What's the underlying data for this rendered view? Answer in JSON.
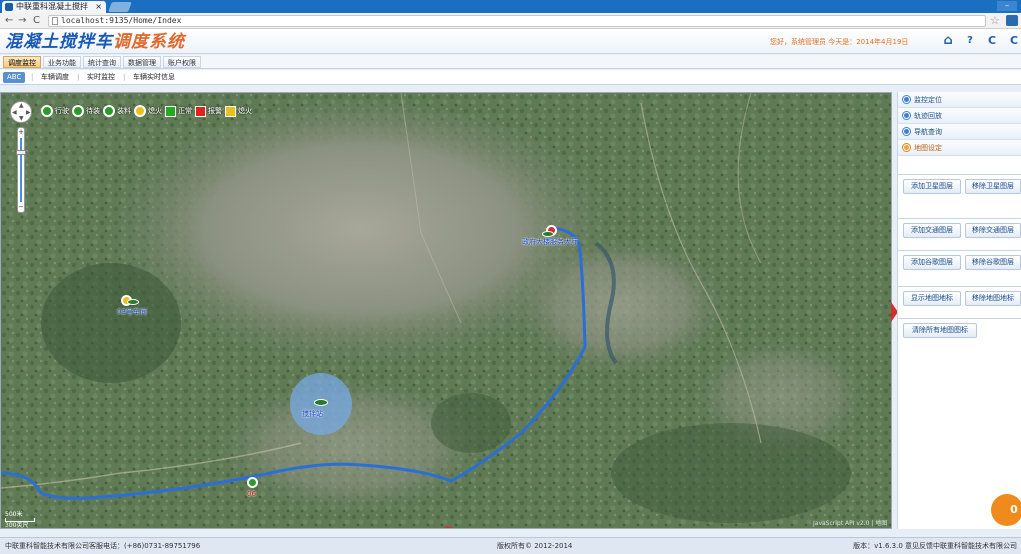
{
  "browser": {
    "tab_title": "中联重科混凝土搅拌",
    "tab_close": "×",
    "url": "localhost:9135/Home/Index",
    "back": "←",
    "forward": "→",
    "reload": "C",
    "star": "☆"
  },
  "header": {
    "title_part1": "混凝土搅拌车",
    "title_part2": "调度系统",
    "welcome": "您好，系统管理员 今天是：2014年4月19日",
    "home_icon": "⌂",
    "help_icon": "?",
    "refresh_icon": "C",
    "more_icon": "C"
  },
  "menu_primary": [
    "调度监控",
    "业务功能",
    "统计查询",
    "数据管理",
    "账户权限"
  ],
  "menu_secondary": [
    "ABC",
    "车辆调度",
    "实时监控",
    "车辆实时信息"
  ],
  "legend": [
    {
      "label": "行驶",
      "color": "#2b9a2b",
      "shape": "dot"
    },
    {
      "label": "待装",
      "color": "#2b9a2b",
      "shape": "dot"
    },
    {
      "label": "装料",
      "color": "#2b9a2b",
      "shape": "dot"
    },
    {
      "label": "熄火",
      "color": "#e8c020",
      "shape": "dot"
    },
    {
      "label": "正常",
      "color": "#22aa22",
      "shape": "sq"
    },
    {
      "label": "报警",
      "color": "#dd2222",
      "shape": "sq"
    },
    {
      "label": "熄火",
      "color": "#e8c020",
      "shape": "sq"
    }
  ],
  "map": {
    "markers": {
      "gov_hall": "政府大楼服务大厅",
      "vehicle_03": "03号车间",
      "mixing_station": "搅拌站",
      "vehicle_06": "06"
    },
    "scale_label": "500米",
    "scale_label2": "300英尺",
    "copyright": "JavaScript API v2.0 | 地图数据"
  },
  "right_panel": {
    "sections": [
      "监控定位",
      "轨迹回放",
      "导航查询",
      "地图设定"
    ],
    "buttons": [
      [
        "添加卫星图层",
        "移除卫星图层"
      ],
      [
        "添加交通图层",
        "移除交通图层"
      ],
      [
        "添加谷歌图层",
        "移除谷歌图层"
      ],
      [
        "显示地图地标",
        "移除地图地标"
      ],
      [
        "清除所有地图图标"
      ]
    ],
    "fab": "0"
  },
  "footer": {
    "left": "中联重科智能技术有限公司客服电话：(+86)0731-89751796",
    "center": "版权所有© 2012-2014",
    "right": "版本：v1.6.3.0 意见反馈中联重科智能技术有限公司"
  }
}
